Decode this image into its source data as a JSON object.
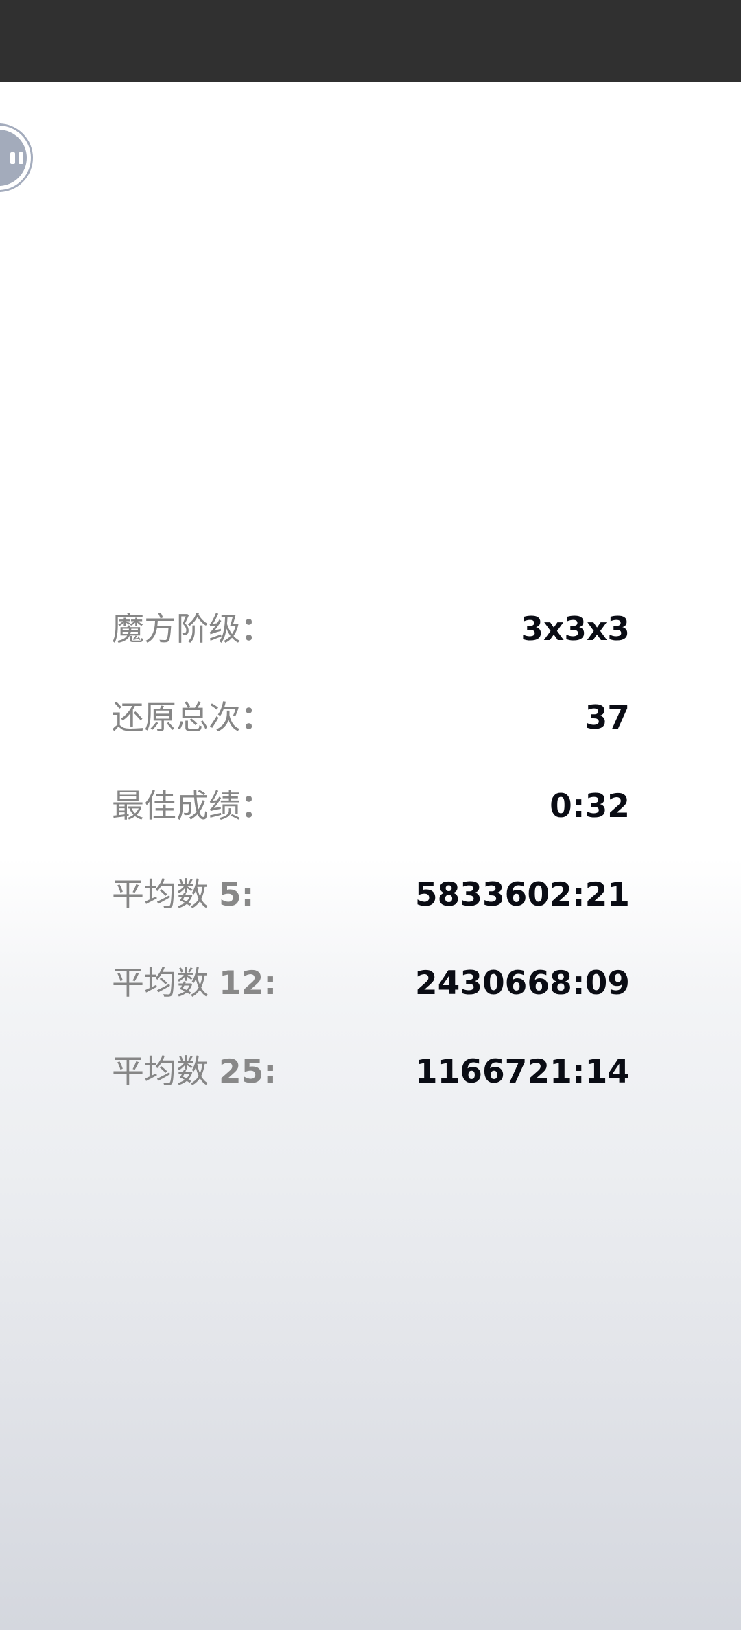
{
  "stats": [
    {
      "label": "魔方阶级",
      "suffix": "：",
      "value": "3x3x3"
    },
    {
      "label": "还原总次",
      "suffix": "：",
      "value": "37"
    },
    {
      "label": "最佳成绩",
      "suffix": "：",
      "value": "0:32"
    },
    {
      "label": "平均数 ",
      "suffix": "5:",
      "value": "5833602:21"
    },
    {
      "label": "平均数 ",
      "suffix": "12:",
      "value": "2430668:09"
    },
    {
      "label": "平均数 ",
      "suffix": "25:",
      "value": "1166721:14"
    }
  ],
  "colors": {
    "status_bar": "#303030",
    "label": "#868686",
    "value": "#0a0c14",
    "fab": "#a3abbb"
  },
  "icons": {
    "floating_button": "pause-icon"
  }
}
